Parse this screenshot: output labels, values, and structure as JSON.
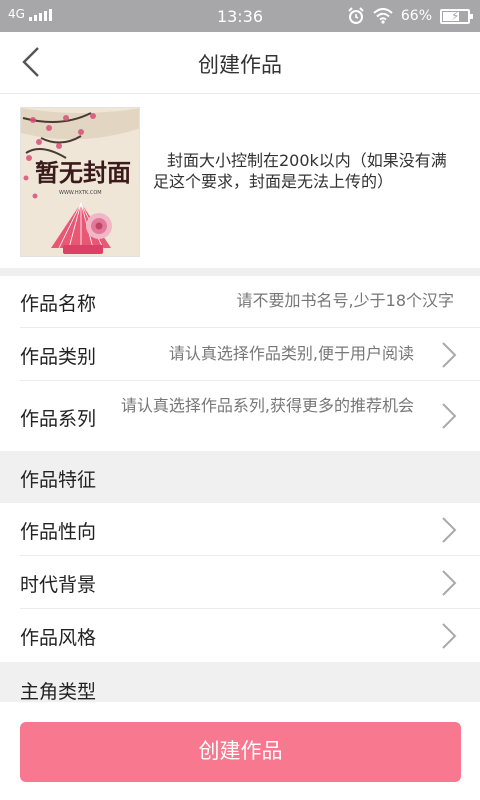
{
  "status_bar": {
    "network": "4G",
    "time": "13:36",
    "battery_percent": "66%",
    "battery_level": 0.66
  },
  "nav": {
    "back_icon": "chevron-left-icon",
    "title": "创建作品"
  },
  "cover": {
    "hint": "封面大小控制在200k以内（如果没有满足这个要求，封面是无法上传的）"
  },
  "form": {
    "name": {
      "label": "作品名称",
      "placeholder": "请不要加书名号,少于18个汉字"
    },
    "category": {
      "label": "作品类别",
      "placeholder": "请认真选择作品类别,便于用户阅读"
    },
    "series": {
      "label": "作品系列",
      "placeholder": "请认真选择作品系列,获得更多的推荐机会"
    }
  },
  "features": {
    "header": "作品特征",
    "items": [
      {
        "label": "作品性向"
      },
      {
        "label": "时代背景"
      },
      {
        "label": "作品风格"
      }
    ]
  },
  "protagonist": {
    "header": "主角类型"
  },
  "actions": {
    "create_label": "创建作品"
  },
  "colors": {
    "accent": "#f7788f",
    "status_bar": "#a7a7a9",
    "section_bg": "#f0f0f0"
  }
}
